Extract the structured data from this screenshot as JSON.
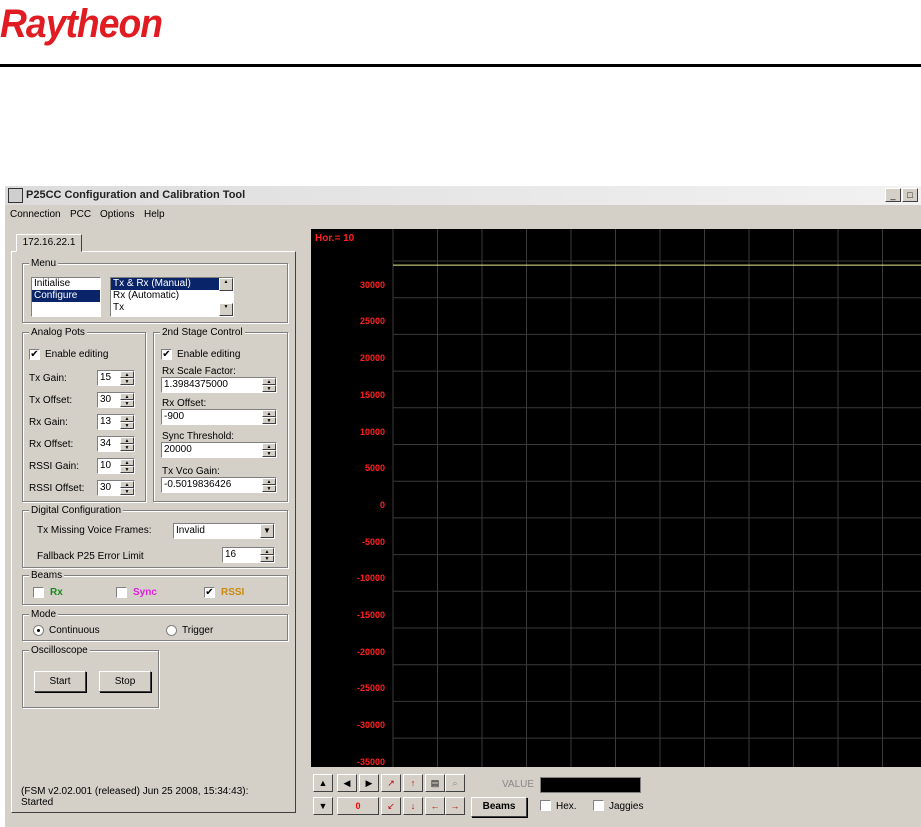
{
  "brand": {
    "logo_text": "Raytheon",
    "logo_color": "#e01b22"
  },
  "window": {
    "title": "P25CC Configuration and Calibration Tool",
    "menu": [
      "Connection",
      "PCC",
      "Options",
      "Help"
    ],
    "tab_label": "172.16.22.1"
  },
  "menu_group": {
    "label": "Menu",
    "left_list": [
      "Initialise",
      "Configure"
    ],
    "left_selected": 1,
    "right_list": [
      "Tx & Rx (Manual)",
      "Rx (Automatic)",
      "Tx"
    ],
    "right_selected": 0
  },
  "analog": {
    "label": "Analog Pots",
    "enable_label": "Enable editing",
    "enable_checked": true,
    "rows": [
      {
        "label": "Tx Gain:",
        "value": "15"
      },
      {
        "label": "Tx Offset:",
        "value": "30"
      },
      {
        "label": "Rx Gain:",
        "value": "13"
      },
      {
        "label": "Rx Offset:",
        "value": "34"
      },
      {
        "label": "RSSI Gain:",
        "value": "10"
      },
      {
        "label": "RSSI Offset:",
        "value": "30"
      }
    ]
  },
  "stage2": {
    "label": "2nd Stage Control",
    "enable_label": "Enable editing",
    "enable_checked": true,
    "fields": [
      {
        "label": "Rx Scale Factor:",
        "value": "1.3984375000"
      },
      {
        "label": "Rx Offset:",
        "value": "-900"
      },
      {
        "label": "Sync Threshold:",
        "value": "20000"
      },
      {
        "label": "Tx Vco Gain:",
        "value": "-0.5019836426"
      }
    ]
  },
  "digital": {
    "label": "Digital Configuration",
    "missing_label": "Tx Missing Voice Frames:",
    "missing_value": "Invalid",
    "fallback_label": "Fallback P25 Error Limit",
    "fallback_value": "16"
  },
  "beams": {
    "label": "Beams",
    "items": [
      {
        "label": "Rx",
        "checked": false,
        "color": "#1a8a1a"
      },
      {
        "label": "Sync",
        "checked": false,
        "color": "#e020e0"
      },
      {
        "label": "RSSI",
        "checked": true,
        "color": "#c88a10"
      }
    ]
  },
  "mode": {
    "label": "Mode",
    "continuous_label": "Continuous",
    "trigger_label": "Trigger",
    "selected": "continuous"
  },
  "oscilloscope": {
    "label": "Oscilloscope",
    "start_label": "Start",
    "stop_label": "Stop"
  },
  "status_text": "(FSM  v2.02.001  (released) Jun 25 2008, 15:34:43):\nStarted",
  "scope": {
    "hor_label": "Hor.=  10",
    "y_ticks": [
      "30000",
      "25000",
      "20000",
      "15000",
      "10000",
      "5000",
      "0",
      "-5000",
      "-10000",
      "-15000",
      "-20000",
      "-25000",
      "-30000",
      "-35000"
    ],
    "trace_color": "#e8e890",
    "trace_value": 32800
  },
  "toolbar": {
    "counter": "0",
    "beams_label": "Beams",
    "value_label": "VALUE",
    "hex_label": "Hex.",
    "jaggies_label": "Jaggies"
  }
}
